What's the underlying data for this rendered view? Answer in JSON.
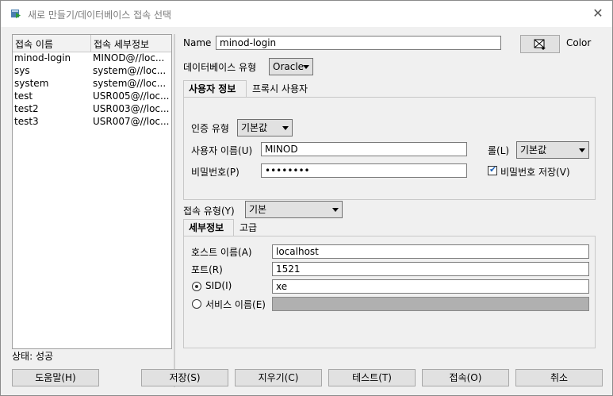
{
  "window": {
    "title": "새로 만들기/데이터베이스 접속 선택"
  },
  "connections": {
    "headers": [
      "접속 이름",
      "접속 세부정보"
    ],
    "rows": [
      [
        "minod-login",
        "MINOD@//loc..."
      ],
      [
        "sys",
        "system@//loc..."
      ],
      [
        "system",
        "system@//loc..."
      ],
      [
        "test",
        "USR005@//loc..."
      ],
      [
        "test2",
        "USR003@//loc..."
      ],
      [
        "test3",
        "USR007@//loc..."
      ]
    ]
  },
  "form": {
    "name_label": "Name",
    "name_value": "minod-login",
    "color_label": "Color",
    "dbtype_label": "데이터베이스 유형",
    "dbtype_value": "Oracle",
    "tabs": [
      "사용자 정보",
      "프록시 사용자"
    ],
    "auth_label": "인증 유형",
    "auth_value": "기본값",
    "user_label": "사용자 이름(U)",
    "user_value": "MINOD",
    "role_label": "롤(L)",
    "role_value": "기본값",
    "pwd_label": "비밀번호(P)",
    "pwd_value": "••••••••",
    "save_pwd_label": "비밀번호 저장(V)",
    "save_pwd_checked": true,
    "conntype_label": "접속 유형(Y)",
    "conntype_value": "기본",
    "subtabs": [
      "세부정보",
      "고급"
    ],
    "host_label": "호스트 이름(A)",
    "host_value": "localhost",
    "port_label": "포트(R)",
    "port_value": "1521",
    "sid_label": "SID(I)",
    "sid_value": "xe",
    "service_label": "서비스 이름(E)",
    "service_value": ""
  },
  "status": "상태: 성공",
  "buttons": {
    "help": "도움말(H)",
    "save": "저장(S)",
    "clear": "지우기(C)",
    "test": "테스트(T)",
    "connect": "접속(O)",
    "cancel": "취소"
  }
}
